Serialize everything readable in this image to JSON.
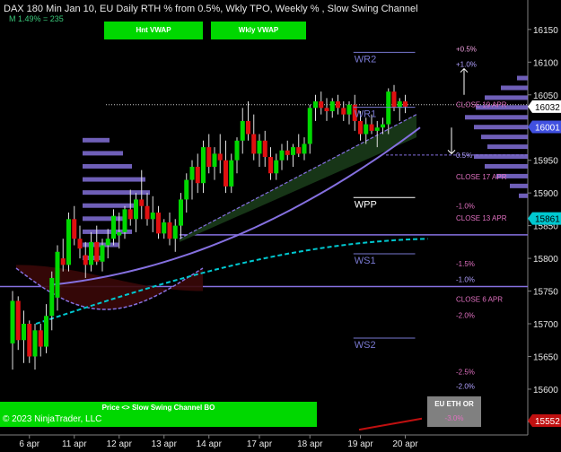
{
  "header": {
    "title": "DAX 180 Min Jan 10, EU Daily RTH % from 0.5%, Wkly TPO, Weekly % , Slow Swing Channel",
    "subtitle": "M 1.49% = 235"
  },
  "buttons": {
    "hnt_vwap": "Hnt VWAP",
    "wkly_vwap": "Wkly VWAP"
  },
  "status": {
    "text": "Price <> Slow Swing Channel BO",
    "copyright": "© 2023 NinjaTrader, LLC"
  },
  "eu_eth_pill": {
    "label": "EU ETH OR",
    "value": "-3.0%"
  },
  "colors": {
    "bg": "#000000",
    "up": "#00d800",
    "down": "#e01010",
    "tpo": "#8370d8",
    "channel_fill": "#183818",
    "lower_fill": "#3a0808",
    "cyan": "#00c8d0",
    "purple": "#8570e0",
    "pink": "#e070c0",
    "green_btn": "#00d800"
  },
  "chart_data": {
    "type": "candlestick",
    "ylim": [
      15530,
      16195
    ],
    "y_ticks": [
      16150,
      16100,
      16050,
      16000,
      15950,
      15900,
      15850,
      15800,
      15750,
      15700,
      15650,
      15600,
      15550
    ],
    "x_labels": [
      "6 apr",
      "11 apr",
      "12 apr",
      "13 apr",
      "14 apr",
      "17 apr",
      "18 apr",
      "19 apr",
      "20 apr"
    ],
    "x_label_bar_index": [
      3,
      11,
      19,
      27,
      35,
      44,
      53,
      62,
      70
    ],
    "candles": [
      [
        15670,
        15750,
        15630,
        15735
      ],
      [
        15735,
        15742,
        15660,
        15675
      ],
      [
        15675,
        15720,
        15640,
        15700
      ],
      [
        15700,
        15705,
        15640,
        15650
      ],
      [
        15650,
        15700,
        15630,
        15690
      ],
      [
        15690,
        15700,
        15650,
        15665
      ],
      [
        15665,
        15730,
        15655,
        15712
      ],
      [
        15712,
        15780,
        15690,
        15770
      ],
      [
        15740,
        15820,
        15720,
        15810
      ],
      [
        15800,
        15830,
        15780,
        15790
      ],
      [
        15790,
        15870,
        15780,
        15860
      ],
      [
        15860,
        15880,
        15820,
        15830
      ],
      [
        15830,
        15850,
        15800,
        15815
      ],
      [
        15805,
        15825,
        15770,
        15790
      ],
      [
        15790,
        15840,
        15780,
        15825
      ],
      [
        15825,
        15850,
        15790,
        15795
      ],
      [
        15795,
        15830,
        15780,
        15820
      ],
      [
        15820,
        15845,
        15800,
        15830
      ],
      [
        15830,
        15875,
        15820,
        15865
      ],
      [
        15835,
        15870,
        15815,
        15840
      ],
      [
        15840,
        15880,
        15830,
        15875
      ],
      [
        15875,
        15905,
        15850,
        15860
      ],
      [
        15860,
        15900,
        15840,
        15890
      ],
      [
        15890,
        15935,
        15860,
        15880
      ],
      [
        15880,
        15900,
        15850,
        15860
      ],
      [
        15860,
        15895,
        15840,
        15870
      ],
      [
        15870,
        15880,
        15830,
        15838
      ],
      [
        15838,
        15860,
        15830,
        15855
      ],
      [
        15855,
        15870,
        15820,
        15830
      ],
      [
        15830,
        15860,
        15810,
        15850
      ],
      [
        15850,
        15900,
        15830,
        15890
      ],
      [
        15890,
        15930,
        15870,
        15920
      ],
      [
        15920,
        15950,
        15890,
        15940
      ],
      [
        15940,
        15960,
        15900,
        15915
      ],
      [
        15915,
        15980,
        15900,
        15970
      ],
      [
        15970,
        15990,
        15930,
        15940
      ],
      [
        15940,
        15970,
        15920,
        15960
      ],
      [
        15960,
        15990,
        15930,
        15950
      ],
      [
        15950,
        15980,
        15900,
        15910
      ],
      [
        15910,
        15960,
        15900,
        15950
      ],
      [
        15950,
        15985,
        15930,
        15980
      ],
      [
        15980,
        16030,
        15960,
        16010
      ],
      [
        16010,
        16040,
        15980,
        15990
      ],
      [
        15990,
        16020,
        15950,
        15960
      ],
      [
        15960,
        15990,
        15940,
        15980
      ],
      [
        15980,
        15995,
        15940,
        15955
      ],
      [
        15955,
        15970,
        15920,
        15930
      ],
      [
        15930,
        15960,
        15920,
        15950
      ],
      [
        15950,
        15975,
        15935,
        15965
      ],
      [
        15965,
        15980,
        15950,
        15958
      ],
      [
        15958,
        15975,
        15940,
        15970
      ],
      [
        15970,
        15990,
        15955,
        15960
      ],
      [
        15960,
        15985,
        15950,
        15975
      ],
      [
        15975,
        16035,
        15960,
        16030
      ],
      [
        16030,
        16050,
        16010,
        16040
      ],
      [
        16040,
        16055,
        16020,
        16030
      ],
      [
        16030,
        16045,
        16010,
        16025
      ],
      [
        16025,
        16045,
        16015,
        16040
      ],
      [
        16040,
        16050,
        16020,
        16030
      ],
      [
        16030,
        16040,
        16010,
        16020
      ],
      [
        16020,
        16040,
        16005,
        16035
      ],
      [
        16035,
        16050,
        15995,
        16010
      ],
      [
        16010,
        16025,
        15980,
        15990
      ],
      [
        15990,
        16015,
        15975,
        16005
      ],
      [
        16005,
        16020,
        15990,
        15995
      ],
      [
        15995,
        16010,
        15970,
        16000
      ],
      [
        16000,
        16015,
        15990,
        16005
      ],
      [
        16005,
        16060,
        15990,
        16055
      ],
      [
        16055,
        16065,
        16025,
        16030
      ],
      [
        16030,
        16045,
        16010,
        16040
      ],
      [
        16040,
        16050,
        16022,
        16032
      ]
    ],
    "levels": [
      {
        "label": "WR2",
        "value": 16115,
        "color": "#7878d0",
        "x0": 0.63,
        "x1": 0.74
      },
      {
        "label": "WR1",
        "value": 16031,
        "color": "#7878d0",
        "x0": 0.63,
        "x1": 0.74
      },
      {
        "label": "WPP",
        "value": 15893,
        "color": "#ffffff",
        "x0": 0.63,
        "x1": 0.74
      },
      {
        "label": "WS1",
        "value": 15807,
        "color": "#7878d0",
        "x0": 0.63,
        "x1": 0.74
      },
      {
        "label": "WS2",
        "value": 15678,
        "color": "#7878d0",
        "x0": 0.63,
        "x1": 0.74
      }
    ],
    "right_labels": [
      {
        "text": "+0.5%",
        "value": 16120,
        "color": "#f0a0e0"
      },
      {
        "text": "+1.0%",
        "value": 16097,
        "color": "#b0a0ff"
      },
      {
        "text": "CLOSE 19 APR",
        "value": 16035,
        "color": "#e070c0"
      },
      {
        "text": "0.5%",
        "value": 15958,
        "color": "#b0a0ff"
      },
      {
        "text": "CLOSE 17 APR",
        "value": 15925,
        "color": "#e070c0"
      },
      {
        "text": "-1.0%",
        "value": 15880,
        "color": "#e070c0"
      },
      {
        "text": "CLOSE 13 APR",
        "value": 15862,
        "color": "#e070c0"
      },
      {
        "text": "-1.5%",
        "value": 15792,
        "color": "#e070c0"
      },
      {
        "text": "-1.0%",
        "value": 15768,
        "color": "#b0a0ff"
      },
      {
        "text": "CLOSE 6 APR",
        "value": 15738,
        "color": "#e070c0"
      },
      {
        "text": "-2.0%",
        "value": 15713,
        "color": "#e070c0"
      },
      {
        "text": "-2.5%",
        "value": 15627,
        "color": "#e070c0"
      },
      {
        "text": "-2.0%",
        "value": 15605,
        "color": "#b0a0ff"
      }
    ],
    "price_tags": [
      {
        "text": "16032",
        "value": 16032,
        "bg": "#ffffff",
        "fg": "#000000"
      },
      {
        "text": "16001",
        "value": 16001,
        "bg": "#4050e0",
        "fg": "#ffffff"
      },
      {
        "text": "15861",
        "value": 15861,
        "bg": "#00c8d0",
        "fg": "#000000"
      },
      {
        "text": "15552",
        "value": 15552,
        "bg": "#c01010",
        "fg": "#ffffff"
      }
    ]
  }
}
